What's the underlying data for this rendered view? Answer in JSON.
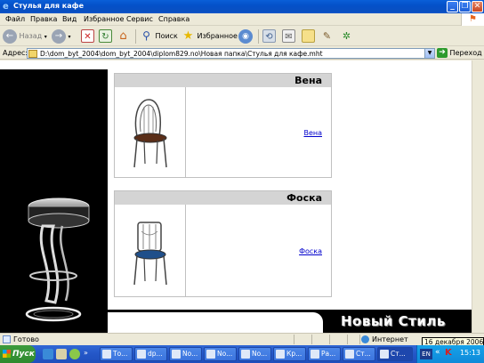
{
  "window": {
    "title": "Стулья для кафе",
    "controls": [
      "_",
      "❐",
      "✕"
    ]
  },
  "menu": [
    "Файл",
    "Правка",
    "Вид",
    "Избранное",
    "Сервис",
    "Справка"
  ],
  "toolbar": {
    "back_label": "Назад",
    "search_label": "Поиск",
    "favorites_label": "Избранное"
  },
  "address": {
    "label": "Адрес:",
    "url": "D:\\dom_byt_2004\\dom_byt_2004\\diplom829.no\\Новая папка\\Стулья для кафе.mht",
    "go_label": "Переход"
  },
  "page": {
    "products": [
      {
        "name": "Вена",
        "link": "Вена"
      },
      {
        "name": "Фоска",
        "link": "Фоска"
      }
    ],
    "brand": "Новый Стиль"
  },
  "status": {
    "text": "Готово",
    "zone": "Интернет",
    "tooltip": "16 декабря 2006 г."
  },
  "taskbar": {
    "start_label": "Пуск",
    "tasks": [
      "То...",
      "dp...",
      "No...",
      "No...",
      "No...",
      "Кр...",
      "Ра...",
      "Ст...",
      "Ст..."
    ],
    "lang": "EN",
    "clock": "15:13"
  },
  "colors": {
    "title_bar": "#0a5fd8",
    "link": "#0000cc",
    "taskbar": "#2456c7",
    "start_button": "#3c9b3c"
  }
}
